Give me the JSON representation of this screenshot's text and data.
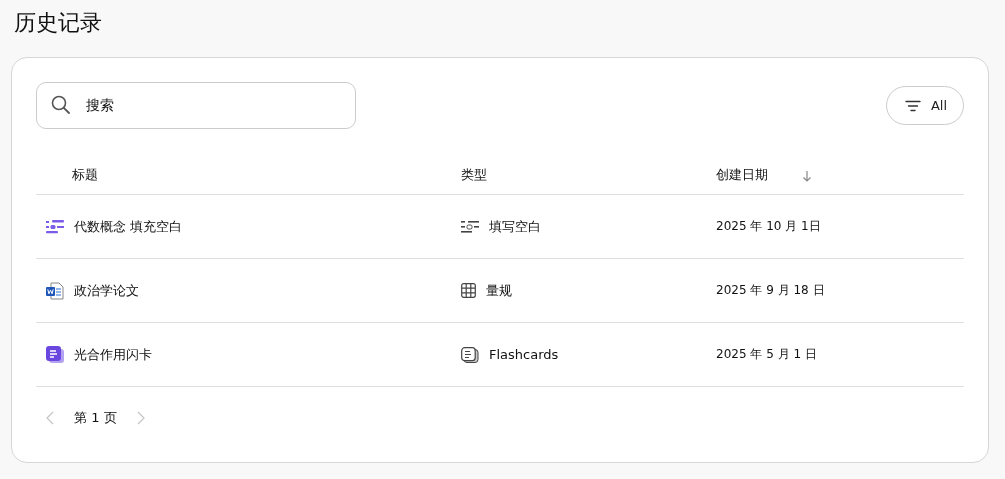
{
  "page_title": "历史记录",
  "search": {
    "value": "搜索"
  },
  "filter_button": {
    "label": "All"
  },
  "table": {
    "columns": [
      {
        "label": "标题",
        "sorted": false
      },
      {
        "label": "类型",
        "sorted": false
      },
      {
        "label": "创建日期",
        "sorted": true
      }
    ],
    "rows": [
      {
        "kind": "fill-blank",
        "title": "代数概念 填充空白",
        "type": "填写空白",
        "date": "2025 年 10 月 1日"
      },
      {
        "kind": "document",
        "title": "政治学论文",
        "type": "量规",
        "date": "2025 年 9 月 18 日"
      },
      {
        "kind": "flashcards",
        "title": "光合作用闪卡",
        "type": "Flashcards",
        "date": "2025 年 5 月 1 日"
      }
    ]
  },
  "pagination": {
    "label": "第 1 页",
    "previous_disabled": true,
    "next_disabled": true
  }
}
